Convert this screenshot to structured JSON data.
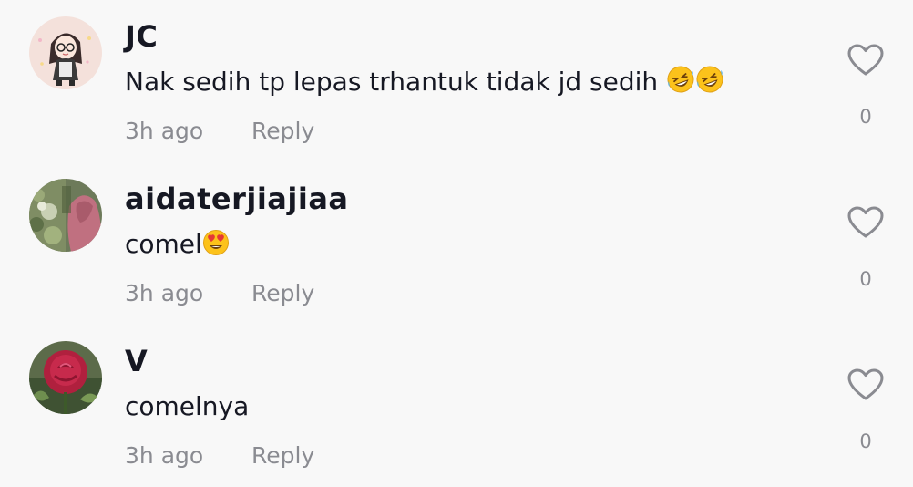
{
  "comments": [
    {
      "username": "JC",
      "text": "Nak sedih tp lepas trhantuk tidak jd sedih ",
      "emojis": [
        "rolling-on-floor-laughing-emoji",
        "rolling-on-floor-laughing-emoji"
      ],
      "time": "3h ago",
      "reply_label": "Reply",
      "likes": "0",
      "avatar": "cartoon-girl-avatar"
    },
    {
      "username": "aidaterjiajiaa",
      "text": "comel",
      "emojis": [
        "heart-eyes-emoji"
      ],
      "time": "3h ago",
      "reply_label": "Reply",
      "likes": "0",
      "avatar": "photo-avatar"
    },
    {
      "username": "V",
      "text": "comelnya",
      "emojis": [],
      "time": "3h ago",
      "reply_label": "Reply",
      "likes": "0",
      "avatar": "rose-avatar"
    }
  ],
  "icons": {
    "like": "heart-outline-icon"
  },
  "colors": {
    "background": "#f8f8f8",
    "text_primary": "#161823",
    "text_secondary": "#8a8b91"
  }
}
